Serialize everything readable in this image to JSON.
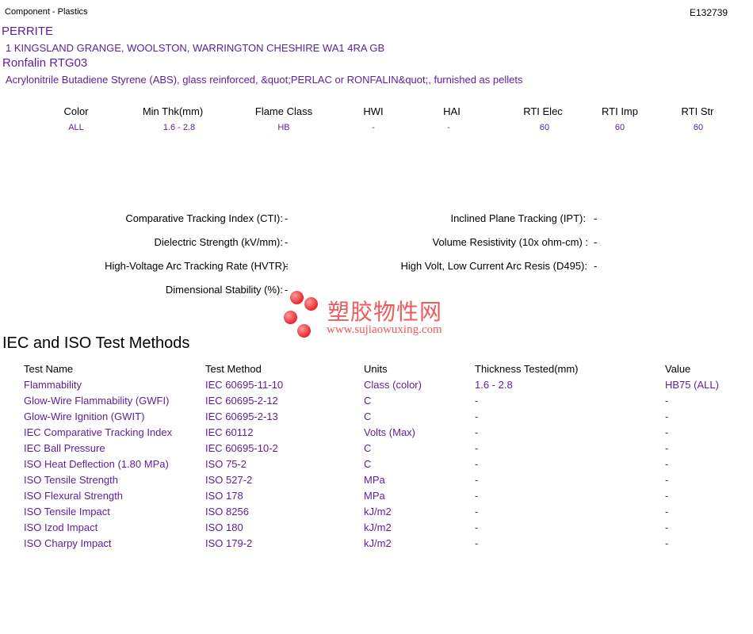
{
  "header": {
    "category": "Component - Plastics",
    "file_number": "E132739"
  },
  "company": {
    "name": "PERRITE",
    "address": "1 KINGSLAND GRANGE, WOOLSTON, WARRINGTON   CHESHIRE WA1  4RA GB"
  },
  "product": {
    "name": "Ronfalin RTG03",
    "description": "Acrylonitrile Butadiene Styrene (ABS), glass reinforced, &quot;PERLAC or RONFALIN&quot;, furnished as pellets"
  },
  "summary": {
    "headers": [
      "Color",
      "Min Thk(mm)",
      "Flame Class",
      "HWI",
      "HAI",
      "RTI Elec",
      "RTI Imp",
      "RTI Str"
    ],
    "values": [
      "ALL",
      "1.6 - 2.8",
      "HB",
      "-",
      "-",
      "60",
      "60",
      "60"
    ]
  },
  "properties": {
    "cti": {
      "label": "Comparative Tracking Index (CTI):",
      "value": "-"
    },
    "ipt": {
      "label": "Inclined Plane Tracking (IPT):",
      "value": "-"
    },
    "dielectric": {
      "label": "Dielectric Strength (kV/mm):",
      "value": "-"
    },
    "volume_resistivity": {
      "label": "Volume Resistivity (10x ohm-cm) :",
      "value": "-"
    },
    "hvtr": {
      "label": "High-Voltage Arc Tracking Rate (HVTR):",
      "value": "-"
    },
    "d495": {
      "label": "High Volt, Low Current Arc Resis (D495):",
      "value": "-"
    },
    "dim_stability": {
      "label": "Dimensional Stability (%):",
      "value": "-"
    }
  },
  "watermark": {
    "cn": "塑胶物性网",
    "url": "www.sujiaowuxing.com"
  },
  "iec_iso": {
    "title": "IEC and ISO Test Methods",
    "columns": [
      "Test Name",
      "Test Method",
      "Units",
      "Thickness Tested(mm)",
      "Value"
    ],
    "rows": [
      [
        "Flammability",
        "IEC 60695-11-10",
        "Class (color)",
        "1.6 - 2.8",
        "HB75 (ALL)"
      ],
      [
        "Glow-Wire Flammability (GWFI)",
        "IEC 60695-2-12",
        "C",
        "-",
        "-"
      ],
      [
        "Glow-Wire Ignition (GWIT)",
        "IEC 60695-2-13",
        "C",
        "-",
        "-"
      ],
      [
        "IEC Comparative Tracking Index",
        "IEC 60112",
        "Volts (Max)",
        "-",
        "-"
      ],
      [
        "IEC Ball Pressure",
        "IEC 60695-10-2",
        "C",
        "-",
        "-"
      ],
      [
        "ISO Heat Deflection (1.80 MPa)",
        "ISO 75-2",
        "C",
        "-",
        "-"
      ],
      [
        "ISO Tensile Strength",
        "ISO 527-2",
        "MPa",
        "-",
        "-"
      ],
      [
        "ISO Flexural Strength",
        "ISO 178",
        "MPa",
        "-",
        "-"
      ],
      [
        "ISO Tensile Impact",
        "ISO 8256",
        "kJ/m2",
        "-",
        "-"
      ],
      [
        "ISO Izod Impact",
        "ISO 180",
        "kJ/m2",
        "-",
        "-"
      ],
      [
        "ISO Charpy Impact",
        "ISO 179-2",
        "kJ/m2",
        "-",
        "-"
      ]
    ]
  }
}
